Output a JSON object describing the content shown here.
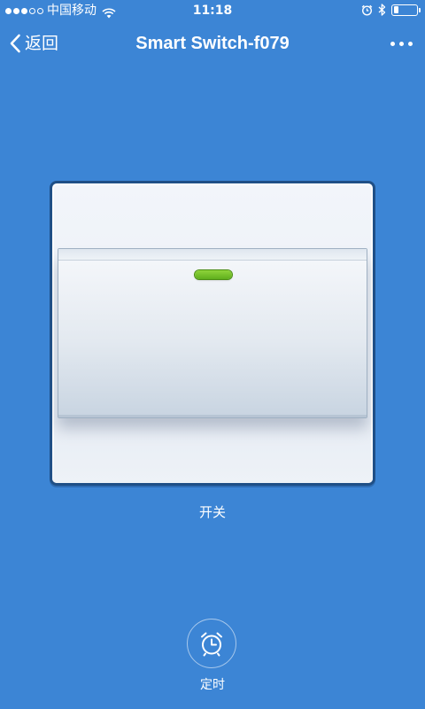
{
  "status_bar": {
    "carrier": "中国移动",
    "time": "11:18",
    "signal_strength": 3,
    "signal_max": 5,
    "battery_level": 0.2,
    "icons": [
      "wifi-icon",
      "alarm-icon",
      "bluetooth-icon",
      "battery-icon"
    ]
  },
  "nav": {
    "back_label": "返回",
    "title": "Smart Switch-f079",
    "more_icon": "more-icon"
  },
  "switch": {
    "label": "开关",
    "state": "on",
    "indicator_color": "#6cbf22"
  },
  "timer": {
    "label": "定时",
    "icon": "alarm-clock-icon"
  },
  "colors": {
    "background": "#3c85d5",
    "plate_border": "#1f4f86"
  }
}
